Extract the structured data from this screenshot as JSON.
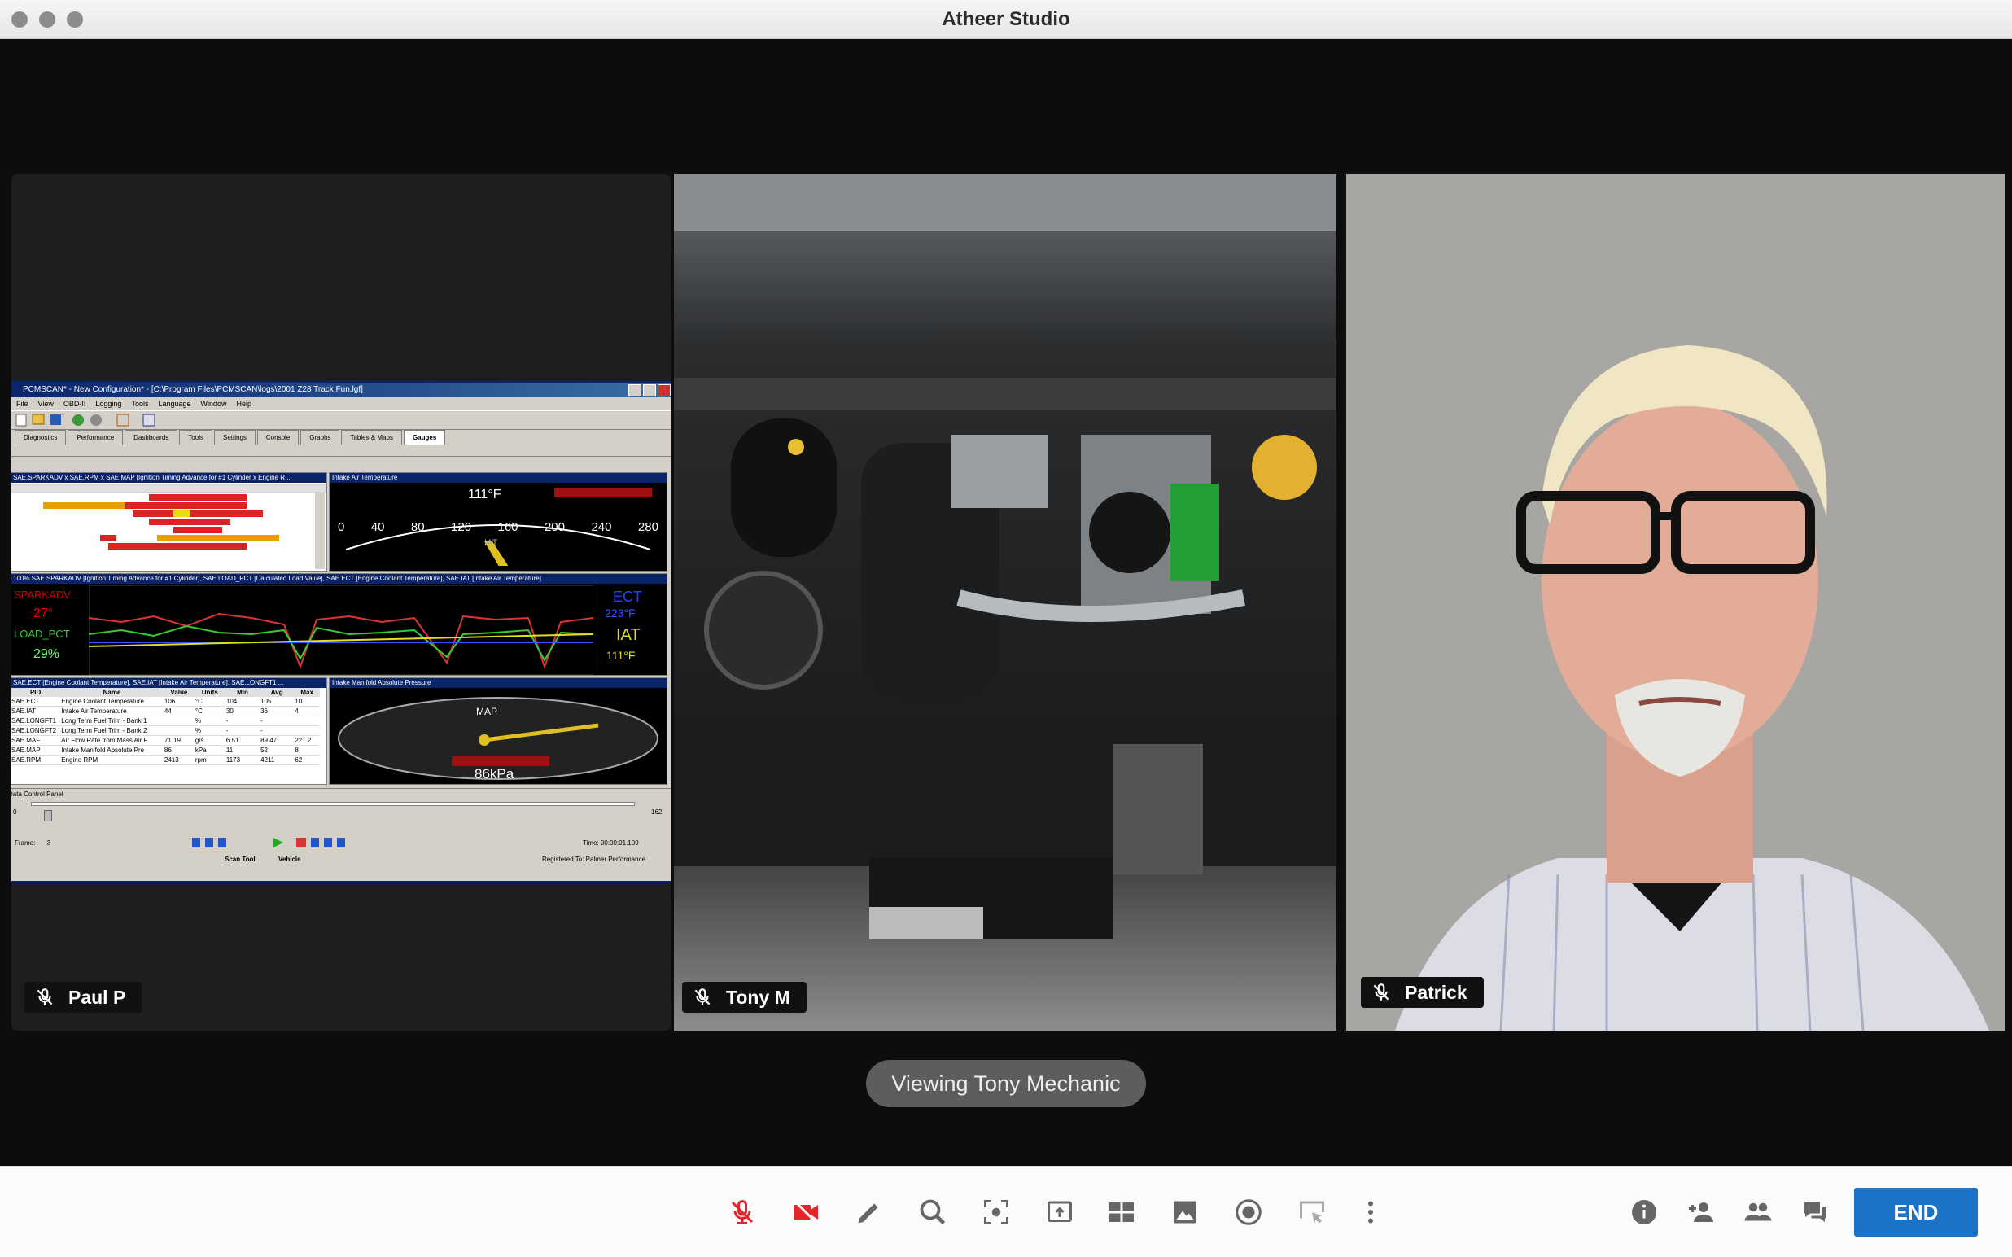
{
  "window": {
    "title": "Atheer Studio"
  },
  "participants": [
    {
      "name": "Paul P"
    },
    {
      "name": "Tony M"
    },
    {
      "name": "Patrick"
    }
  ],
  "viewing_label": "Viewing Tony Mechanic",
  "toolbar": {
    "end_label": "END"
  },
  "pcmscan": {
    "title": "PCMSCAN* - New Configuration* - [C:\\Program Files\\PCMSCAN\\logs\\2001 Z28 Track Fun.lgf]",
    "menu": [
      "File",
      "View",
      "OBD-II",
      "Logging",
      "Tools",
      "Language",
      "Window",
      "Help"
    ],
    "tabs": [
      "Diagnostics",
      "Performance",
      "Dashboards",
      "Tools",
      "Settings",
      "Console",
      "Graphs",
      "Tables & Maps",
      "Gauges"
    ],
    "pane_spark": "SAE.SPARKADV x SAE.RPM x SAE.MAP [Ignition Timing Advance for #1 Cylinder x Engine R...",
    "pane_iat": "Intake Air Temperature",
    "iat_value": "111°F",
    "iat_label": "IAT",
    "iat_ticks": [
      "0",
      "40",
      "80",
      "120",
      "160",
      "200",
      "240",
      "280"
    ],
    "pane_graph": "100% SAE.SPARKADV [Ignition Timing Advance for #1 Cylinder], SAE.LOAD_PCT [Calculated Load Value], SAE.ECT [Engine Coolant Temperature], SAE.IAT [Intake Air Temperature]",
    "graph_labels": {
      "spark": "SPARKADV",
      "spark_val": "27°",
      "load": "LOAD_PCT",
      "load_val": "29%",
      "ect": "ECT",
      "ect_val": "223°F",
      "iat": "IAT",
      "iat_val": "111°F"
    },
    "pane_table": "SAE.ECT [Engine Coolant Temperature], SAE.IAT [Intake Air Temperature], SAE.LONGFT1 ...",
    "table_headers": [
      "PID",
      "Name",
      "Value",
      "Units",
      "Min",
      "Avg",
      "Max"
    ],
    "table_rows": [
      [
        "SAE.ECT",
        "Engine Coolant Temperature",
        "106",
        "°C",
        "104",
        "105",
        "10"
      ],
      [
        "SAE.IAT",
        "Intake Air Temperature",
        "44",
        "°C",
        "30",
        "36",
        "4"
      ],
      [
        "SAE.LONGFT1",
        "Long Term Fuel Trim - Bank 1",
        "",
        "%",
        "-",
        "-",
        ""
      ],
      [
        "SAE.LONGFT2",
        "Long Term Fuel Trim - Bank 2",
        "",
        "%",
        "-",
        "-",
        ""
      ],
      [
        "SAE.MAF",
        "Air Flow Rate from Mass Air F",
        "71.19",
        "g/s",
        "6.51",
        "89.47",
        "221.2"
      ],
      [
        "SAE.MAP",
        "Intake Manifold Absolute Pre",
        "86",
        "kPa",
        "11",
        "52",
        "8"
      ],
      [
        "SAE.RPM",
        "Engine RPM",
        "2413",
        "rpm",
        "1173",
        "4211",
        "62"
      ]
    ],
    "pane_map": "Intake Manifold Absolute Pressure",
    "map_label": "MAP",
    "map_value": "86kPa",
    "data_panel": "Data Control Panel",
    "frame_label": "Frame:",
    "frame_value": "3",
    "time_label": "Time:",
    "time_value": "00:00:01.109",
    "slider_min": "0",
    "slider_max": "162",
    "legend_scan": "Scan Tool",
    "legend_vehicle": "Vehicle",
    "registered": "Registered To: Palmer Performance"
  }
}
